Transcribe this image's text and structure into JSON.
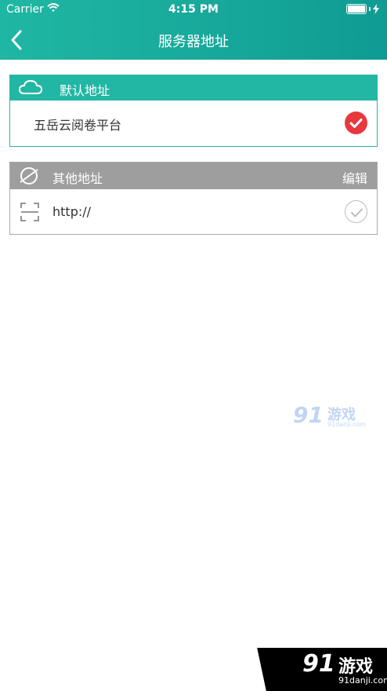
{
  "status_bar": {
    "carrier": "Carrier",
    "time": "4:15 PM"
  },
  "nav": {
    "title": "服务器地址",
    "back_icon": "chevron-left-icon"
  },
  "default_section": {
    "header": "默认地址",
    "header_icon": "cloud-icon",
    "item": {
      "label": "五岳云阅卷平台",
      "selected": true
    }
  },
  "other_section": {
    "header": "其他地址",
    "header_icon": "planet-icon",
    "edit_label": "编辑",
    "item": {
      "label": "http://",
      "selected": false,
      "icon": "scan-icon"
    }
  },
  "watermark": {
    "number": "91",
    "name": "游戏",
    "url": "91danji.com"
  },
  "badge": {
    "number": "91",
    "name": "游戏",
    "url": "91danji.com"
  },
  "colors": {
    "accent": "#22b7a4",
    "check_on": "#e8383d",
    "section_gray": "#9e9e9e"
  }
}
